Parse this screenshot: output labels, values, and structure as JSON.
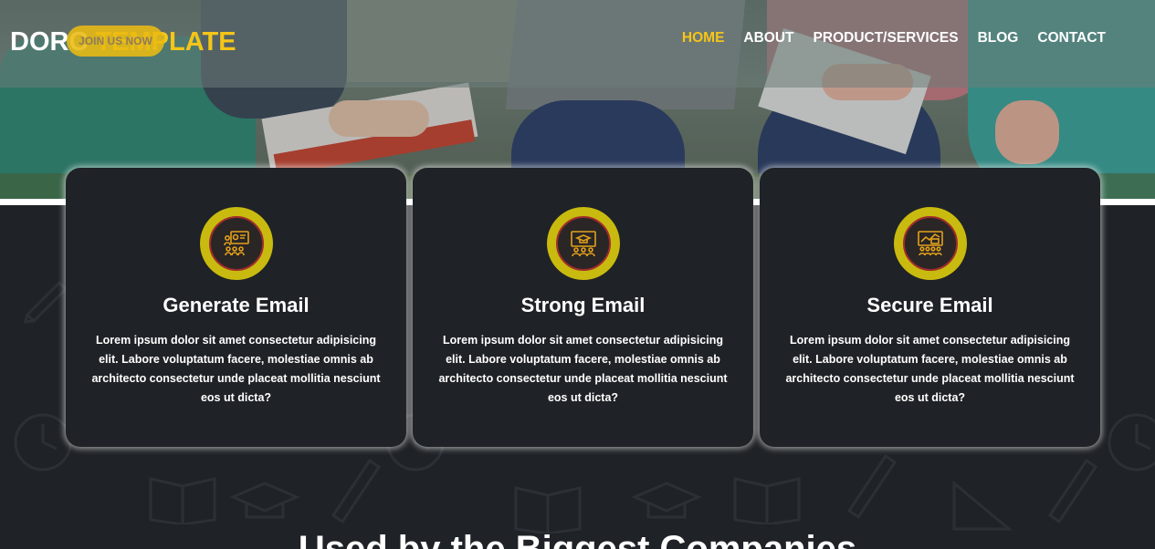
{
  "header": {
    "logo_main": "DORC ",
    "logo_accent": "TEMPLATE",
    "join_button": "JOIN US NOW",
    "nav": [
      {
        "label": "HOME",
        "active": true
      },
      {
        "label": "ABOUT",
        "active": false
      },
      {
        "label": "PRODUCT/SERVICES",
        "active": false
      },
      {
        "label": "BLOG",
        "active": false
      },
      {
        "label": "CONTACT",
        "active": false
      }
    ]
  },
  "features": [
    {
      "icon": "classroom-presentation-icon",
      "title": "Generate Email",
      "text": "Lorem ipsum dolor sit amet consectetur adipisicing elit. Labore voluptatum facere, molestiae omnis ab architecto consectetur unde placeat mollitia nesciunt eos ut dicta?"
    },
    {
      "icon": "graduation-board-icon",
      "title": "Strong Email",
      "text": "Lorem ipsum dolor sit amet consectetur adipisicing elit. Labore voluptatum facere, molestiae omnis ab architecto consectetur unde placeat mollitia nesciunt eos ut dicta?"
    },
    {
      "icon": "chart-audience-icon",
      "title": "Secure Email",
      "text": "Lorem ipsum dolor sit amet consectetur adipisicing elit. Labore voluptatum facere, molestiae omnis ab architecto consectetur unde placeat mollitia nesciunt eos ut dicta?"
    }
  ],
  "section_heading": "Used by the Biggest Companies",
  "colors": {
    "accent": "#f5c518",
    "dark_bg": "#1f2226",
    "icon_ring": "#c9ba0f",
    "icon_stroke": "#e3a01a"
  }
}
